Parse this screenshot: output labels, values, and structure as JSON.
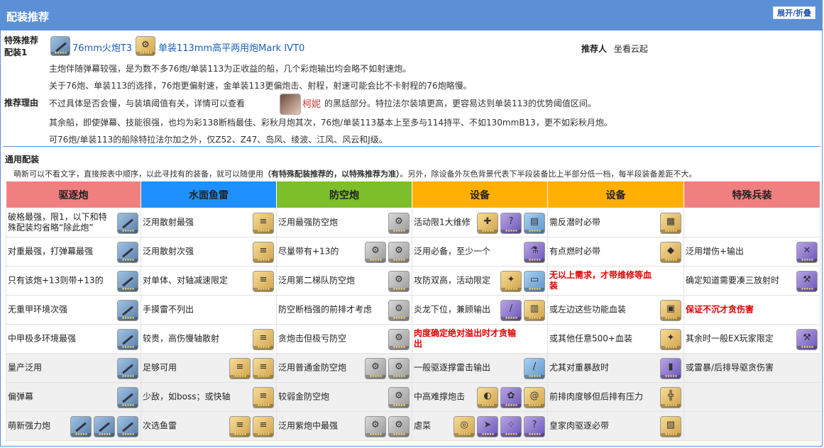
{
  "panel": {
    "title": "配装推荐",
    "toggle_label": "展开/折叠",
    "header_color": "#5b90d6"
  },
  "special": {
    "label_line1": "特殊推荐",
    "label_line2": "配装1",
    "equip1": "76mm火炮T3",
    "equip2": "单装113mm高平两用炮Mark IVT0",
    "recommender_label": "推荐人",
    "recommender_name": "坐看云起",
    "reason_label": "推荐理由",
    "reason_lines": [
      "主炮伴随弹幕较强，是为数不多76炮/单装113为正收益的船，几个彩炮输出均会略不如射速炮。",
      "关于76炮、单装113的选择，76炮更偏射速，金单装113更偏炮击、射程，射速可能会比不卡射程的76炮略慢。",
      "不过具体是否会慢，与装填阈值有关，详情可以查看",
      "柯妮",
      "的黑話部分。特拉法尔装填更高，更容易达到单装113的优势阈值区间。",
      "其余船，即使弹幕、技能很强，也均为彩138断档最佳、彩秋月炮其次，76炮/单装113基本上至多与114持平、不如130mmB13，更不如彩秋月炮。",
      "可76炮/单装113的船除特拉法尔加之外，仅Z52、Z47、岛风、绫波、江风、风云和J级。"
    ]
  },
  "general": {
    "title": "通用配装",
    "desc_pre": "萌新可以不看文字，直接按表中顺序，以此寻找有的装备，就可以随便用",
    "desc_bold": "（有特殊配装推荐的，以特殊推荐为准）",
    "desc_post": "。另外，除设备外灰色背景代表下半段装备比上半部分低一档，每半段装备差距不大。"
  },
  "table": {
    "headers": [
      {
        "label": "驱逐炮",
        "color": "#f08080"
      },
      {
        "label": "水面鱼雷",
        "color": "#1e90ff"
      },
      {
        "label": "防空炮",
        "color": "#7cbf2a"
      },
      {
        "label": "设备",
        "color": "#ffb000"
      },
      {
        "label": "设备",
        "color": "#ffb000"
      },
      {
        "label": "特殊兵装",
        "color": "#f08080"
      }
    ],
    "rows": [
      {
        "grey": false,
        "cells": [
          {
            "text": "破格最强，限1，以下和特殊配装均省略“除此炮”",
            "red": false,
            "icons": [
              "gun-icon"
            ]
          },
          {
            "text": "泛用散射最强",
            "red": false,
            "icons": [
              "torpedo-icon"
            ]
          },
          {
            "text": "泛用最强防空炮",
            "red": false,
            "icons": [
              "aa-gun-icon"
            ]
          },
          {
            "text": "活动限1大维修",
            "red": false,
            "icons": [
              "repair-icon",
              "box-icon",
              "kit-icon"
            ]
          },
          {
            "text": "需反潜时必带",
            "red": false,
            "icons": [
              "sonar-icon"
            ]
          },
          {
            "text": "",
            "red": false,
            "icons": []
          }
        ]
      },
      {
        "grey": false,
        "cells": [
          {
            "text": "对重最强，打弹幕最强",
            "red": false,
            "icons": [
              "gun-icon"
            ]
          },
          {
            "text": "泛用散射次强",
            "red": false,
            "icons": [
              "torpedo-icon"
            ]
          },
          {
            "text": "尽量带有+13的",
            "red": false,
            "icons": [
              "aa-gun-icon",
              "aa-gun-icon"
            ]
          },
          {
            "text": "泛用必备，至少一个",
            "red": false,
            "icons": [
              "fuel-icon"
            ]
          },
          {
            "text": "有点燃时必带",
            "red": false,
            "icons": [
              "extinguisher-icon"
            ]
          },
          {
            "text": "泛用增伤+输出",
            "red": false,
            "icons": [
              "swords-icon"
            ]
          }
        ]
      },
      {
        "grey": false,
        "cells": [
          {
            "text": "只有该炮+13则带+13的",
            "red": false,
            "icons": [
              "gun-icon"
            ]
          },
          {
            "text": "对单体、对轴减速限定",
            "red": false,
            "icons": [
              "torpedo-icon"
            ]
          },
          {
            "text": "泛用第二梯队防空炮",
            "red": false,
            "icons": [
              "aa-gun-icon"
            ]
          },
          {
            "text": "攻防双高，活动限定",
            "red": false,
            "icons": [
              "gear-icon",
              "tablet-icon"
            ]
          },
          {
            "text": "无以上需求，才带维修等血装",
            "red": true,
            "icons": []
          },
          {
            "text": "确定知道需要凑三放射时",
            "red": false,
            "icons": [
              "hammer-icon"
            ]
          }
        ]
      },
      {
        "grey": false,
        "cells": [
          {
            "text": "无重甲环境次强",
            "red": false,
            "icons": [
              "gun-icon"
            ]
          },
          {
            "text": "手摸雷不列出",
            "red": false,
            "icons": []
          },
          {
            "text": "防空断档强的前排才考虑",
            "red": false,
            "icons": [
              "aa-gun-icon"
            ]
          },
          {
            "text": "炎龙下位，兼顾输出",
            "red": false,
            "icons": [
              "bar-icon",
              "trap-icon"
            ]
          },
          {
            "text": "或左边这些功能血装",
            "red": false,
            "icons": [
              "toolbox-icon"
            ]
          },
          {
            "text": "保证不沉才贪伤害",
            "red": true,
            "icons": []
          }
        ]
      },
      {
        "grey": false,
        "cells": [
          {
            "text": "中甲极多环境最强",
            "red": false,
            "icons": [
              "gun-icon"
            ]
          },
          {
            "text": "较贵，高伤慢轴散射",
            "red": false,
            "icons": [
              "torpedo-icon"
            ]
          },
          {
            "text": "贪炮击但极亏防空",
            "red": false,
            "icons": [
              "aa-gun-icon"
            ]
          },
          {
            "text": "肉度确定绝对溢出时才贪输出",
            "red": true,
            "icons": []
          },
          {
            "text": "或其他任意500+血装",
            "red": false,
            "icons": [
              "gear-icon"
            ]
          },
          {
            "text": "其余时一般EX玩家限定",
            "red": false,
            "icons": [
              "hammer-icon"
            ]
          }
        ]
      },
      {
        "grey": true,
        "cells": [
          {
            "text": "量产泛用",
            "red": false,
            "icons": [
              "gun-icon"
            ]
          },
          {
            "text": "足够可用",
            "red": false,
            "icons": [
              "torpedo-icon",
              "torpedo-icon"
            ]
          },
          {
            "text": "泛用普通金防空炮",
            "red": false,
            "icons": [
              "aa-gun-icon",
              "aa-gun-icon"
            ]
          },
          {
            "text": "一般驱逐撑雷击输出",
            "red": false,
            "icons": [
              "pen-icon"
            ]
          },
          {
            "text": "尤其对重暴敌时",
            "red": false,
            "icons": [
              "book-icon"
            ]
          },
          {
            "text": "或雷暴/后排导驱贪伤害",
            "red": false,
            "icons": []
          }
        ]
      },
      {
        "grey": true,
        "cells": [
          {
            "text": "偏弹幕",
            "red": false,
            "icons": [
              "gun-icon"
            ]
          },
          {
            "text": "少敌，如boss；或快轴",
            "red": false,
            "icons": [
              "torpedo-icon"
            ]
          },
          {
            "text": "较弱金防空炮",
            "red": false,
            "icons": [
              "aa-gun-icon"
            ]
          },
          {
            "text": "中高难撑炮击",
            "red": false,
            "icons": [
              "capsule-icon",
              "flower-icon",
              "spiral-icon"
            ]
          },
          {
            "text": "前排肉度够但后排有压力",
            "red": false,
            "icons": [
              "cannon-icon"
            ]
          },
          {
            "text": "",
            "red": false,
            "icons": []
          }
        ]
      },
      {
        "grey": true,
        "cells": [
          {
            "text": "萌新强力炮",
            "red": false,
            "icons": [
              "gun-icon",
              "gun-icon",
              "gun-icon"
            ]
          },
          {
            "text": "次选鱼雷",
            "red": false,
            "icons": [
              "torpedo-icon",
              "torpedo-icon"
            ]
          },
          {
            "text": "泛用紫炮中最强",
            "red": false,
            "icons": [
              "aa-gun-icon",
              "aa-gun-icon"
            ]
          },
          {
            "text": "虐菜",
            "red": false,
            "icons": [
              "radar-icon",
              "missile-icon",
              "cluster-icon",
              "box-icon"
            ]
          },
          {
            "text": "皇家肉驱逐必带",
            "red": false,
            "icons": [
              "plate-icon"
            ]
          },
          {
            "text": "",
            "red": false,
            "icons": []
          }
        ]
      }
    ]
  }
}
